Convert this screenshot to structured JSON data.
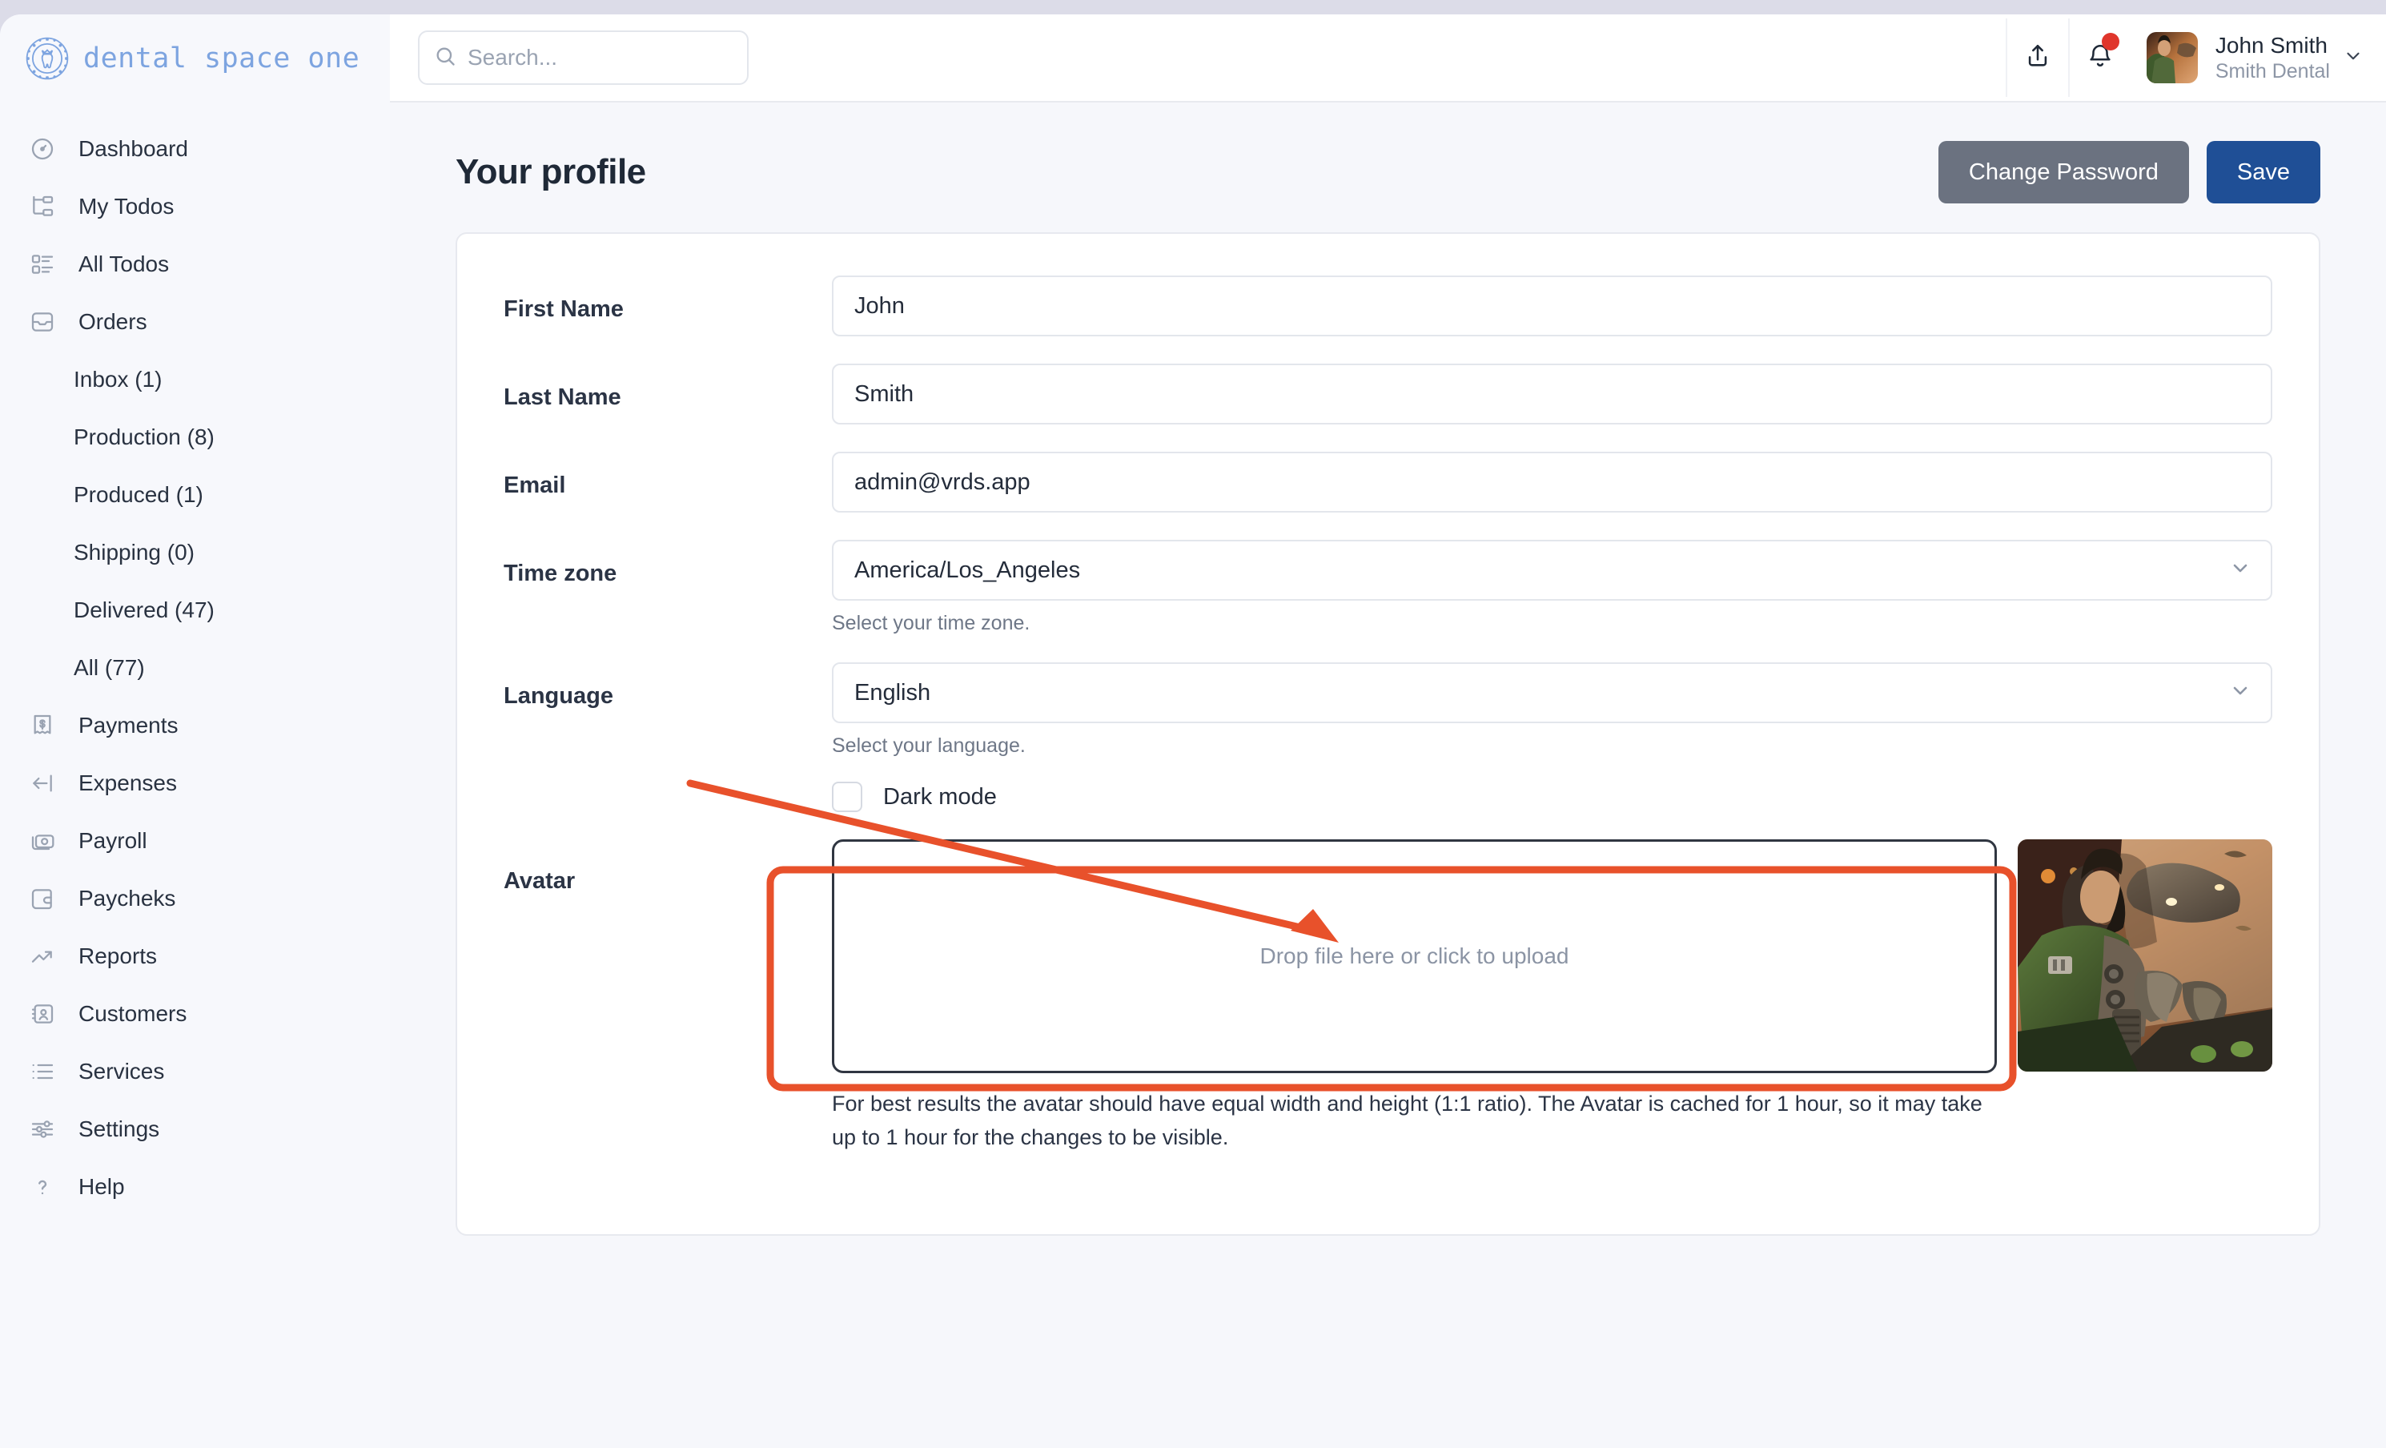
{
  "brand": {
    "name": "dental space one",
    "logo_icon": "tooth-crown-circle-icon",
    "color": "#7da4e0"
  },
  "topbar": {
    "search": {
      "placeholder": "Search...",
      "value": "",
      "icon": "search-icon"
    },
    "share_icon": "share-icon",
    "bell_icon": "bell-icon",
    "has_notification": true,
    "user": {
      "name": "John Smith",
      "org": "Smith Dental",
      "chevron_icon": "chevron-down-icon",
      "avatar_icon": "user-avatar-image"
    }
  },
  "sidebar": {
    "items": [
      {
        "label": "Dashboard",
        "icon": "gauge-icon"
      },
      {
        "label": "My Todos",
        "icon": "org-tree-icon"
      },
      {
        "label": "All Todos",
        "icon": "checklist-icon"
      },
      {
        "label": "Orders",
        "icon": "inbox-tray-icon"
      }
    ],
    "order_children": [
      {
        "label": "Inbox (1)"
      },
      {
        "label": "Production (8)"
      },
      {
        "label": "Produced (1)"
      },
      {
        "label": "Shipping (0)"
      },
      {
        "label": "Delivered (47)"
      },
      {
        "label": "All (77)"
      }
    ],
    "items_lower": [
      {
        "label": "Payments",
        "icon": "receipt-dollar-icon"
      },
      {
        "label": "Expenses",
        "icon": "arrow-left-bar-icon"
      },
      {
        "label": "Payroll",
        "icon": "banknote-icon"
      },
      {
        "label": "Paycheks",
        "icon": "wallet-icon"
      },
      {
        "label": "Reports",
        "icon": "trending-up-icon"
      },
      {
        "label": "Customers",
        "icon": "contact-card-icon"
      },
      {
        "label": "Services",
        "icon": "list-icon"
      },
      {
        "label": "Settings",
        "icon": "sliders-icon"
      },
      {
        "label": "Help",
        "icon": "question-mark-icon"
      }
    ]
  },
  "page": {
    "title": "Your profile",
    "change_password_label": "Change Password",
    "save_label": "Save"
  },
  "form": {
    "first_name": {
      "label": "First Name",
      "value": "John"
    },
    "last_name": {
      "label": "Last Name",
      "value": "Smith"
    },
    "email": {
      "label": "Email",
      "value": "admin@vrds.app"
    },
    "timezone": {
      "label": "Time zone",
      "value": "America/Los_Angeles",
      "hint": "Select your time zone.",
      "chevron_icon": "chevron-down-icon"
    },
    "language": {
      "label": "Language",
      "value": "English",
      "hint": "Select your language.",
      "chevron_icon": "chevron-down-icon"
    },
    "dark_mode": {
      "label": "Dark mode",
      "checked": false
    },
    "avatar": {
      "label": "Avatar",
      "dropzone_text": "Drop file here or click to upload",
      "note": "For best results the avatar should have equal width and height (1:1 ratio). The Avatar is cached for 1 hour, so it may take up to 1 hour for the changes to be visible.",
      "preview_icon": "avatar-preview-image"
    }
  },
  "annotation": {
    "color": "#e8512b",
    "shape": "arrow-and-highlight-rect"
  }
}
